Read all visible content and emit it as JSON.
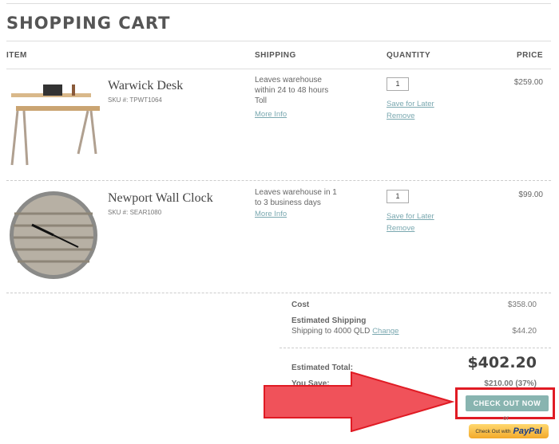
{
  "page": {
    "title": "SHOPPING CART"
  },
  "columns": {
    "item": "ITEM",
    "shipping": "SHIPPING",
    "quantity": "QUANTITY",
    "price": "PRICE"
  },
  "items": [
    {
      "name": "Warwick Desk",
      "sku": "SKU #: TPWT1064",
      "shipping": [
        "Leaves warehouse",
        "within 24 to 48 hours",
        "Toll"
      ],
      "more_info": "More Info",
      "quantity": "1",
      "save_for_later": "Save for Later",
      "remove": "Remove",
      "price": "$259.00"
    },
    {
      "name": "Newport Wall Clock",
      "sku": "SKU #: SEAR1080",
      "shipping": [
        "Leaves warehouse in 1",
        "to 3 business days"
      ],
      "more_info": "More Info",
      "quantity": "1",
      "save_for_later": "Save for Later",
      "remove": "Remove",
      "price": "$99.00"
    }
  ],
  "summary": {
    "cost_label": "Cost",
    "cost": "$358.00",
    "est_shipping_label": "Estimated Shipping",
    "shipping_to": "Shipping to 4000 QLD",
    "change": "Change",
    "shipping": "$44.20",
    "total_label": "Estimated Total:",
    "total": "$402.20",
    "save_label": "You Save:",
    "save": "$210.00 (37%)",
    "checkout": "CHECK OUT NOW",
    "or": "or",
    "paypal_prefix": "Check Out with",
    "paypal_brand": "PayPal"
  },
  "colors": {
    "accent": "#88b4b0",
    "link": "#7aa8b0",
    "highlight": "#e01b24",
    "arrow": "#f0525a"
  }
}
